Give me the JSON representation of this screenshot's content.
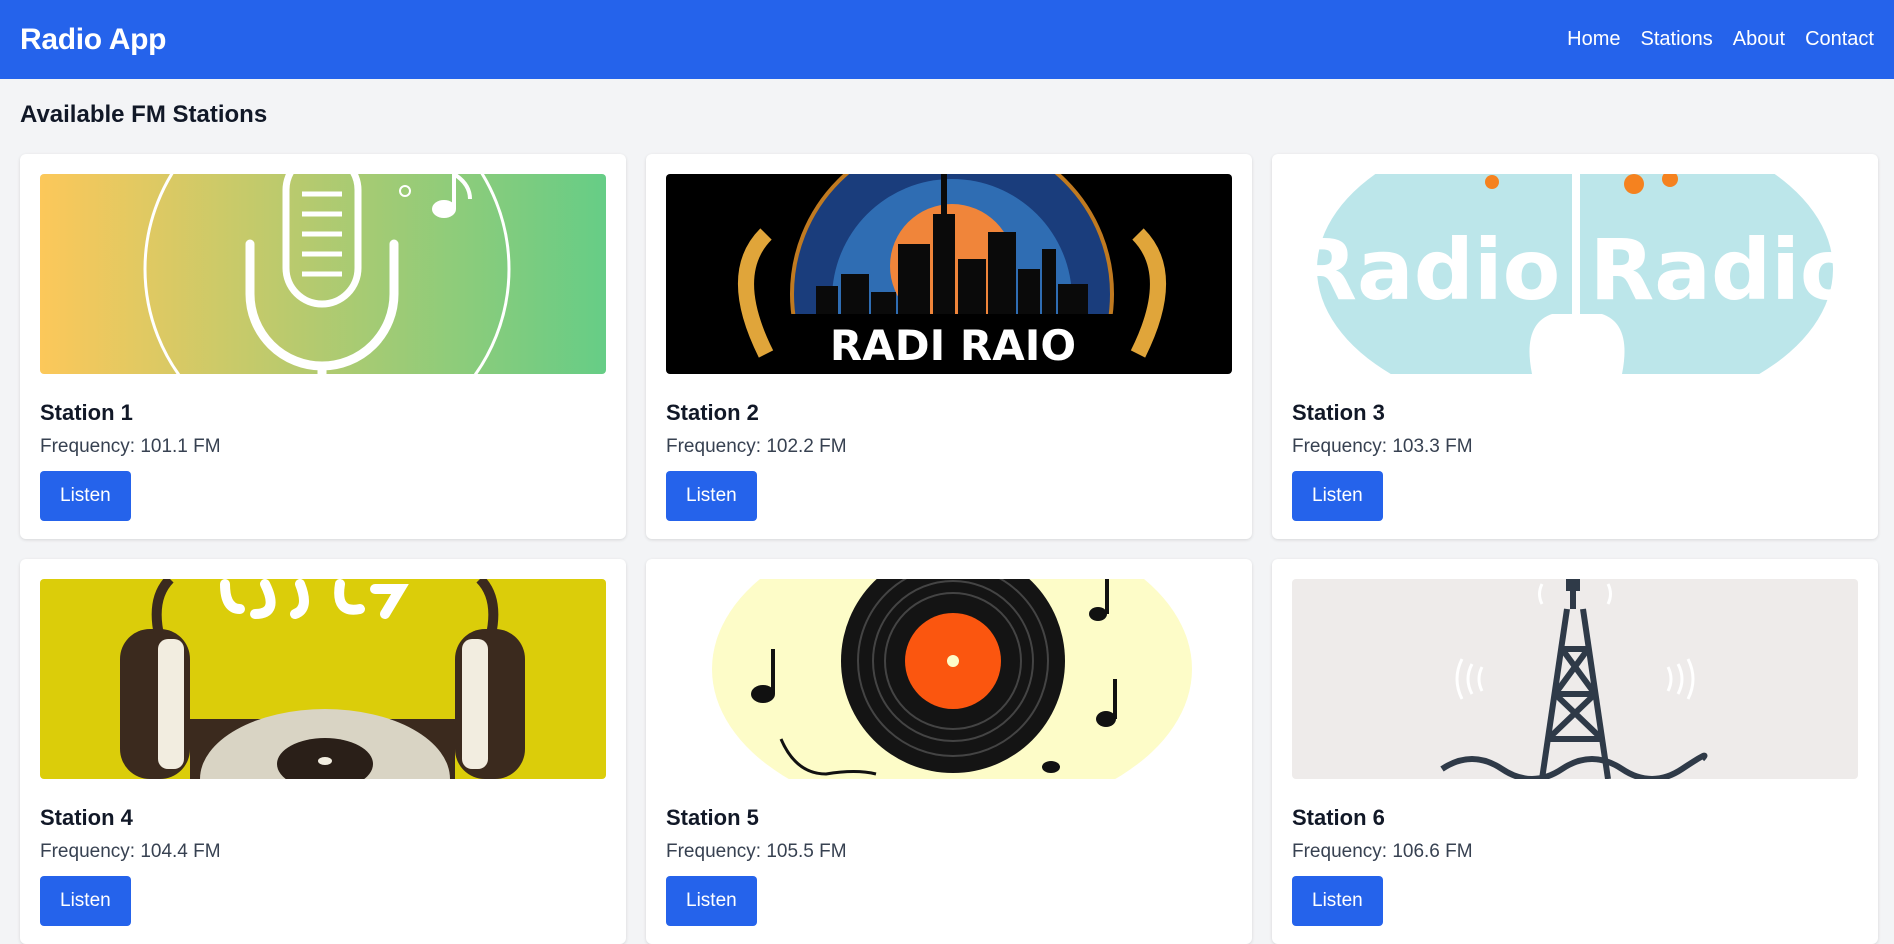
{
  "app": {
    "title": "Radio App"
  },
  "nav": {
    "items": [
      "Home",
      "Stations",
      "About",
      "Contact"
    ]
  },
  "page": {
    "title": "Available FM Stations"
  },
  "colors": {
    "primary": "#2563eb",
    "background": "#f3f4f6"
  },
  "stations": [
    {
      "name": "Station 1",
      "frequency": "Frequency: 101.1 FM",
      "button": "Listen",
      "image": "microphone-logo"
    },
    {
      "name": "Station 2",
      "frequency": "Frequency: 102.2 FM",
      "button": "Listen",
      "image": "city-headphones-logo",
      "image_text": "RADI RAIO"
    },
    {
      "name": "Station 3",
      "frequency": "Frequency: 103.3 FM",
      "button": "Listen",
      "image": "guitar-radio-logo",
      "image_text": "Radio Radio"
    },
    {
      "name": "Station 4",
      "frequency": "Frequency: 104.4 FM",
      "button": "Listen",
      "image": "headphones-turntable-logo"
    },
    {
      "name": "Station 5",
      "frequency": "Frequency: 105.5 FM",
      "button": "Listen",
      "image": "vinyl-notes-logo"
    },
    {
      "name": "Station 6",
      "frequency": "Frequency: 106.6 FM",
      "button": "Listen",
      "image": "radio-tower-logo"
    }
  ]
}
